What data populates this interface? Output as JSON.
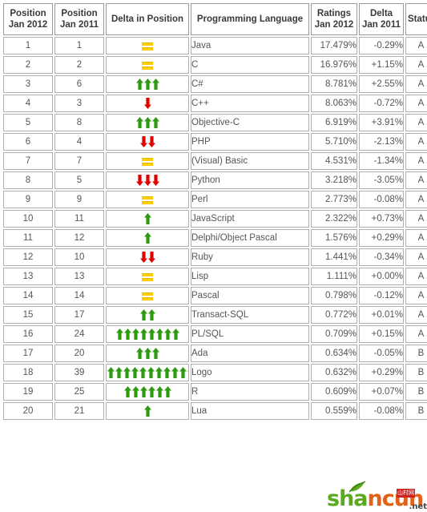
{
  "table": {
    "headers": [
      {
        "name": "position-jan-2012",
        "line1": "Position",
        "line2": "Jan 2012"
      },
      {
        "name": "position-jan-2011",
        "line1": "Position",
        "line2": "Jan 2011"
      },
      {
        "name": "delta-in-position",
        "line1": "Delta in Position",
        "line2": ""
      },
      {
        "name": "programming-language",
        "line1": "Programming Language",
        "line2": ""
      },
      {
        "name": "ratings-jan-2012",
        "line1": "Ratings",
        "line2": "Jan 2012"
      },
      {
        "name": "delta-jan-2011",
        "line1": "Delta",
        "line2": "Jan 2011"
      },
      {
        "name": "status",
        "line1": "Status",
        "line2": ""
      }
    ],
    "rows": [
      {
        "pos2012": "1",
        "pos2011": "1",
        "delta_icon": "equals",
        "delta_count": 0,
        "language": "Java",
        "ratings": "17.479%",
        "delta": "-0.29%",
        "status": "A"
      },
      {
        "pos2012": "2",
        "pos2011": "2",
        "delta_icon": "equals",
        "delta_count": 0,
        "language": "C",
        "ratings": "16.976%",
        "delta": "+1.15%",
        "status": "A"
      },
      {
        "pos2012": "3",
        "pos2011": "6",
        "delta_icon": "arrow-up",
        "delta_count": 3,
        "language": "C#",
        "ratings": "8.781%",
        "delta": "+2.55%",
        "status": "A"
      },
      {
        "pos2012": "4",
        "pos2011": "3",
        "delta_icon": "arrow-down",
        "delta_count": 1,
        "language": "C++",
        "ratings": "8.063%",
        "delta": "-0.72%",
        "status": "A"
      },
      {
        "pos2012": "5",
        "pos2011": "8",
        "delta_icon": "arrow-up",
        "delta_count": 3,
        "language": "Objective-C",
        "ratings": "6.919%",
        "delta": "+3.91%",
        "status": "A"
      },
      {
        "pos2012": "6",
        "pos2011": "4",
        "delta_icon": "arrow-down",
        "delta_count": 2,
        "language": "PHP",
        "ratings": "5.710%",
        "delta": "-2.13%",
        "status": "A"
      },
      {
        "pos2012": "7",
        "pos2011": "7",
        "delta_icon": "equals",
        "delta_count": 0,
        "language": "(Visual) Basic",
        "ratings": "4.531%",
        "delta": "-1.34%",
        "status": "A"
      },
      {
        "pos2012": "8",
        "pos2011": "5",
        "delta_icon": "arrow-down",
        "delta_count": 3,
        "language": "Python",
        "ratings": "3.218%",
        "delta": "-3.05%",
        "status": "A"
      },
      {
        "pos2012": "9",
        "pos2011": "9",
        "delta_icon": "equals",
        "delta_count": 0,
        "language": "Perl",
        "ratings": "2.773%",
        "delta": "-0.08%",
        "status": "A"
      },
      {
        "pos2012": "10",
        "pos2011": "11",
        "delta_icon": "arrow-up",
        "delta_count": 1,
        "language": "JavaScript",
        "ratings": "2.322%",
        "delta": "+0.73%",
        "status": "A"
      },
      {
        "pos2012": "11",
        "pos2011": "12",
        "delta_icon": "arrow-up",
        "delta_count": 1,
        "language": "Delphi/Object Pascal",
        "ratings": "1.576%",
        "delta": "+0.29%",
        "status": "A"
      },
      {
        "pos2012": "12",
        "pos2011": "10",
        "delta_icon": "arrow-down",
        "delta_count": 2,
        "language": "Ruby",
        "ratings": "1.441%",
        "delta": "-0.34%",
        "status": "A"
      },
      {
        "pos2012": "13",
        "pos2011": "13",
        "delta_icon": "equals",
        "delta_count": 0,
        "language": "Lisp",
        "ratings": "1.111%",
        "delta": "+0.00%",
        "status": "A"
      },
      {
        "pos2012": "14",
        "pos2011": "14",
        "delta_icon": "equals",
        "delta_count": 0,
        "language": "Pascal",
        "ratings": "0.798%",
        "delta": "-0.12%",
        "status": "A"
      },
      {
        "pos2012": "15",
        "pos2011": "17",
        "delta_icon": "arrow-up",
        "delta_count": 2,
        "language": "Transact-SQL",
        "ratings": "0.772%",
        "delta": "+0.01%",
        "status": "A"
      },
      {
        "pos2012": "16",
        "pos2011": "24",
        "delta_icon": "arrow-up",
        "delta_count": 8,
        "language": "PL/SQL",
        "ratings": "0.709%",
        "delta": "+0.15%",
        "status": "A"
      },
      {
        "pos2012": "17",
        "pos2011": "20",
        "delta_icon": "arrow-up",
        "delta_count": 3,
        "language": "Ada",
        "ratings": "0.634%",
        "delta": "-0.05%",
        "status": "B"
      },
      {
        "pos2012": "18",
        "pos2011": "39",
        "delta_icon": "arrow-up",
        "delta_count": 11,
        "language": "Logo",
        "ratings": "0.632%",
        "delta": "+0.29%",
        "status": "B"
      },
      {
        "pos2012": "19",
        "pos2011": "25",
        "delta_icon": "arrow-up",
        "delta_count": 6,
        "language": "R",
        "ratings": "0.609%",
        "delta": "+0.07%",
        "status": "B"
      },
      {
        "pos2012": "20",
        "pos2011": "21",
        "delta_icon": "arrow-up",
        "delta_count": 1,
        "language": "Lua",
        "ratings": "0.559%",
        "delta": "-0.08%",
        "status": "B"
      }
    ]
  },
  "watermark": {
    "part1": "sha",
    "part2": "ncun",
    "badge": "山村网",
    "suffix": ".net"
  },
  "colors": {
    "arrow_up": "#2e9a10",
    "arrow_down": "#e00000",
    "equals": "#ffcc00",
    "language_text": "#6b9ac4",
    "cell_text": "#555555"
  }
}
